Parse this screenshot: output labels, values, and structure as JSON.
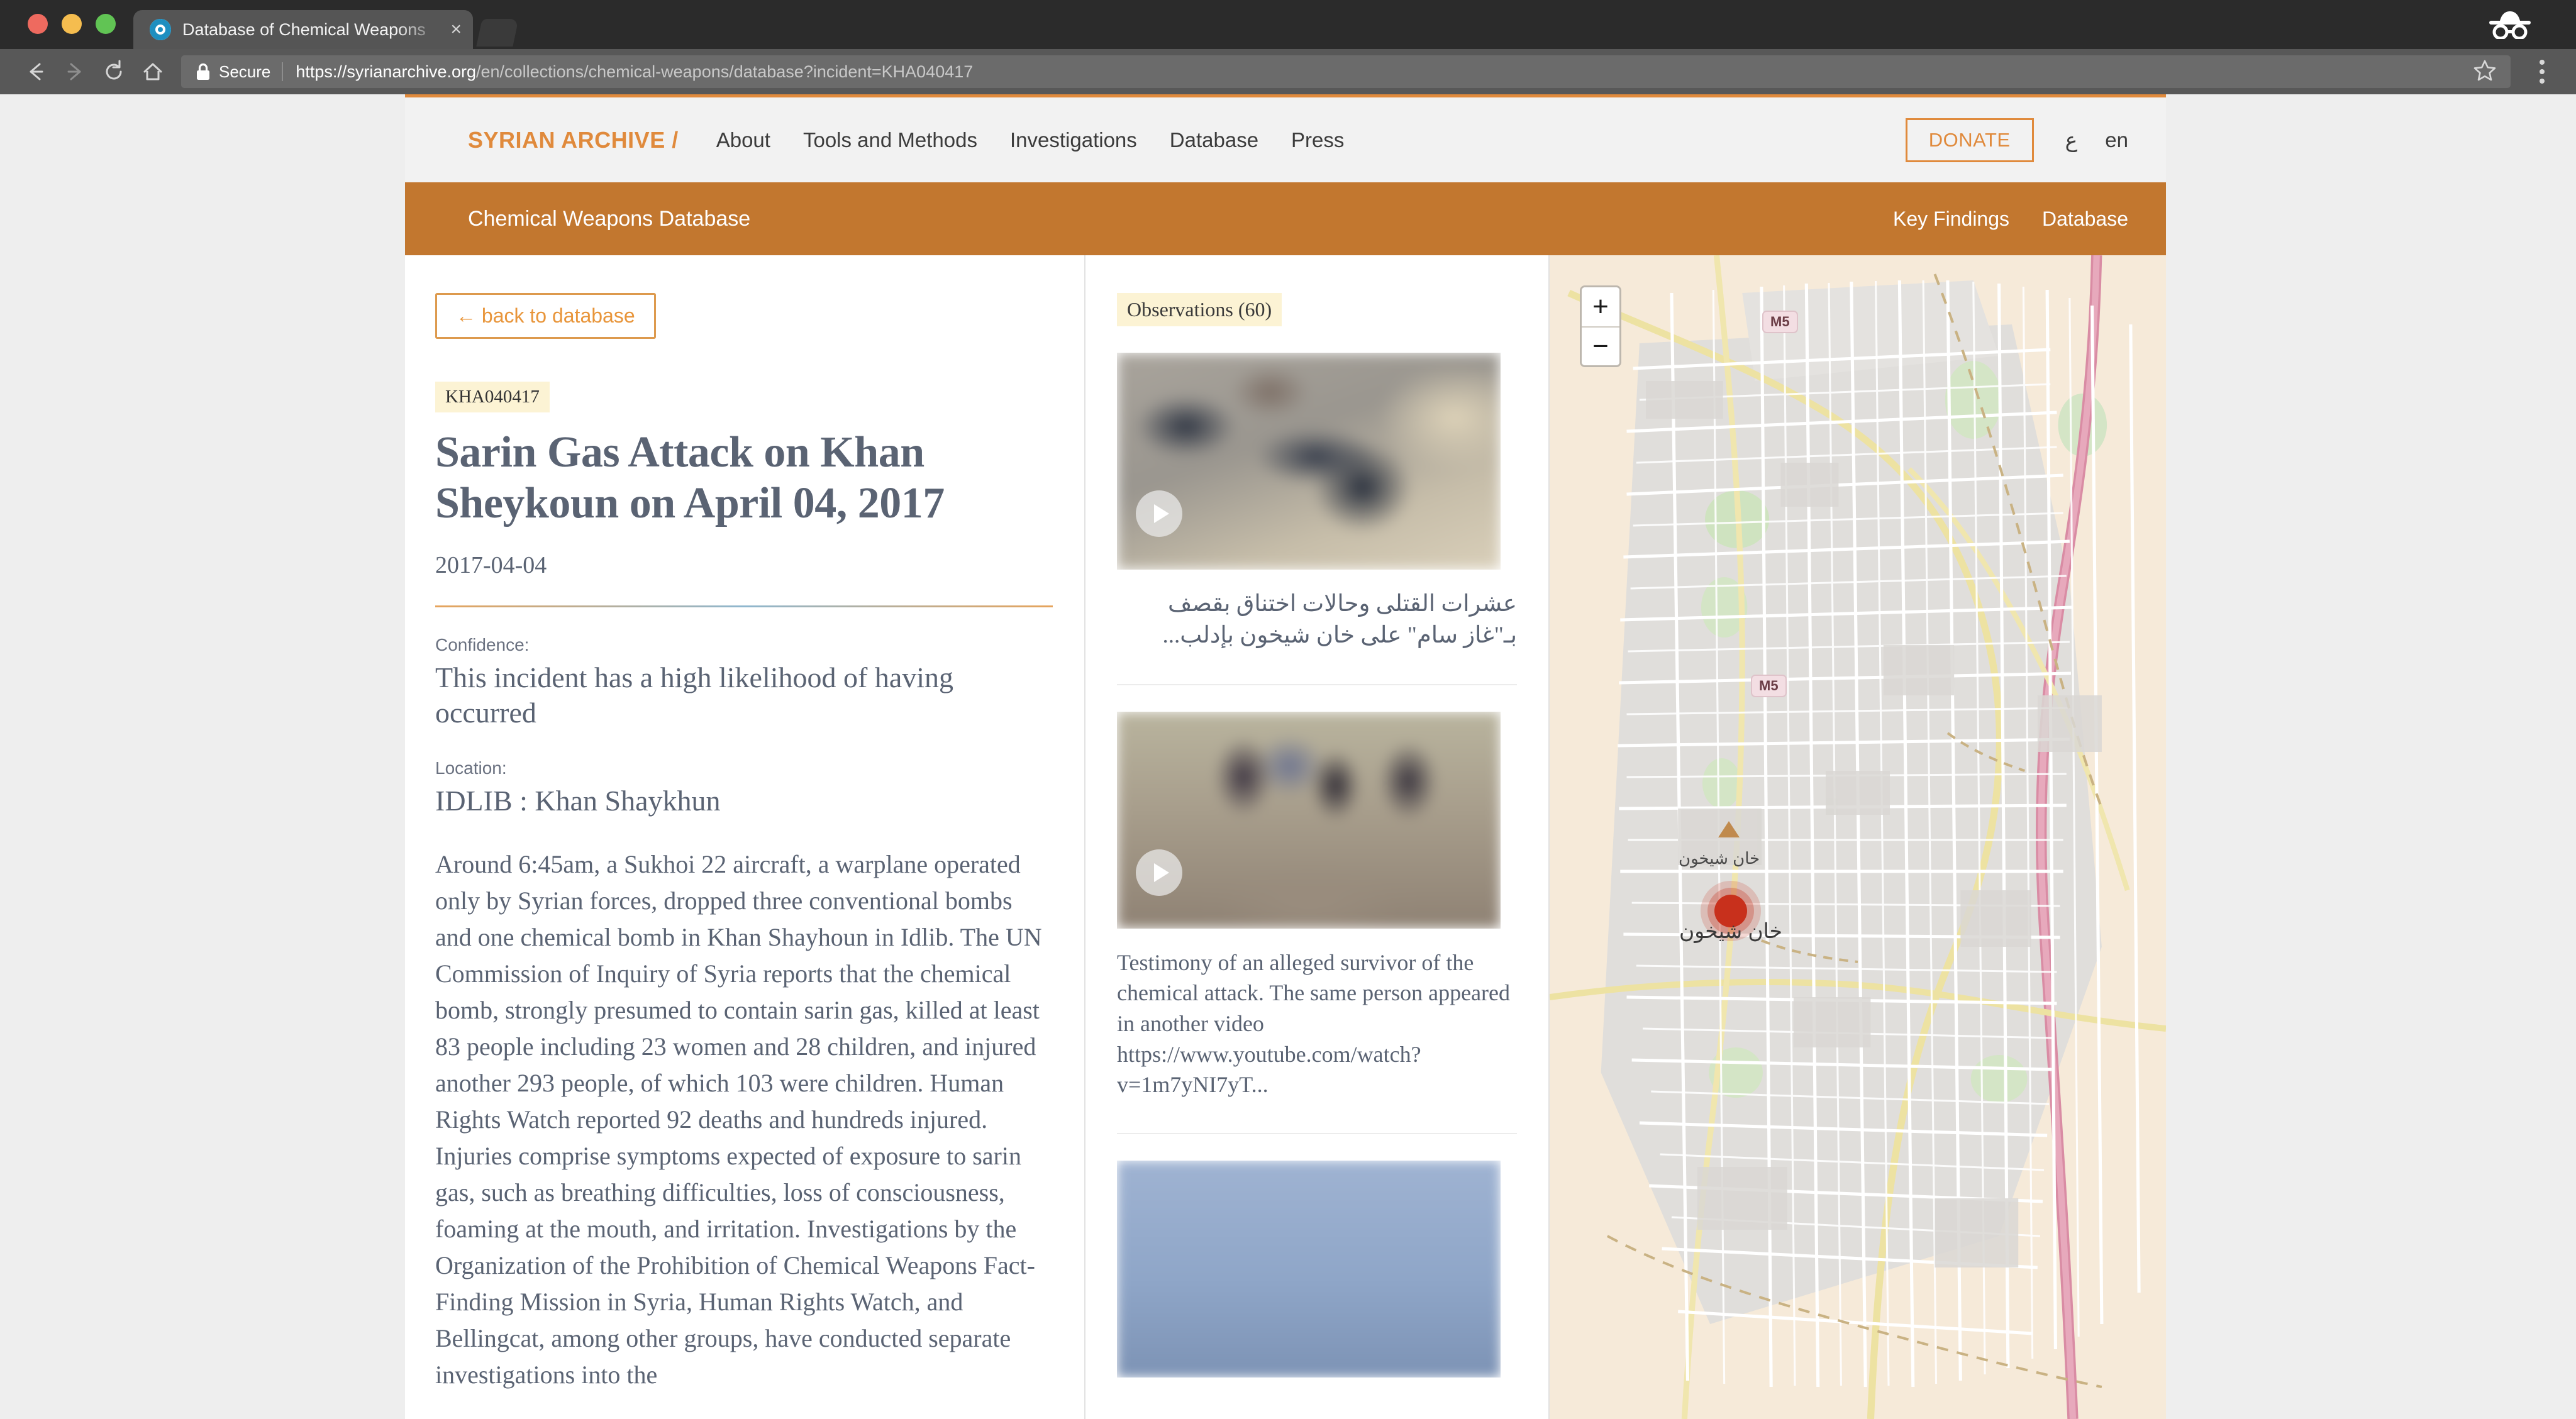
{
  "browser": {
    "tab_title": "Database of Chemical Weapons",
    "tab_close_glyph": "×",
    "back_glyph": "←",
    "forward_glyph": "→",
    "reload_glyph": "↻",
    "home_glyph": "⌂",
    "secure_label": "Secure",
    "url_host": "https://syrianarchive.org",
    "url_path": "/en/collections/chemical-weapons/database?incident=KHA040417",
    "star_glyph": "☆"
  },
  "mainnav": {
    "brand": "SYRIAN ARCHIVE /",
    "links": [
      {
        "label": "About"
      },
      {
        "label": "Tools and Methods"
      },
      {
        "label": "Investigations"
      },
      {
        "label": "Database"
      },
      {
        "label": "Press"
      }
    ],
    "donate_label": "DONATE",
    "lang_ar": "ع",
    "lang_en": "en"
  },
  "subnav": {
    "title": "Chemical Weapons Database",
    "links": [
      {
        "label": "Key Findings"
      },
      {
        "label": "Database"
      }
    ]
  },
  "incident": {
    "back_label": "← back to database",
    "id": "KHA040417",
    "title": "Sarin Gas Attack on Khan Sheykoun on April 04, 2017",
    "date": "2017-04-04",
    "confidence_label": "Confidence:",
    "confidence_value": "This incident has a high likelihood of having occurred",
    "location_label": "Location:",
    "location_value": "IDLIB : Khan Shaykhun",
    "description": "Around 6:45am, a Sukhoi 22 aircraft, a warplane operated only by Syrian forces, dropped three conventional bombs and one chemical bomb in Khan Shayhoun in Idlib.  The UN Commission of Inquiry of Syria  reports that the chemical bomb, strongly presumed to contain sarin gas, killed at least 83 people including 23 women and 28 children, and injured another 293 people, of which 103 were children. Human Rights Watch reported 92 deaths and hundreds injured. Injuries comprise symptoms expected of exposure to sarin gas, such as breathing difficulties, loss of consciousness, foaming at the mouth, and irritation. Investigations by the Organization of the Prohibition of Chemical Weapons Fact-Finding Mission in Syria, Human Rights Watch, and Bellingcat, among other groups, have conducted separate investigations into the"
  },
  "observations": {
    "header": "Observations (60)",
    "count": 60,
    "items": [
      {
        "caption": "عشرات القتلى وحالات اختناق بقصف بـ\"غاز سام\" على خان شيخون بإدلب...",
        "rtl": true,
        "media": "video"
      },
      {
        "caption": "Testimony of an alleged survivor of the chemical attack. The same person appeared in another video https://www.youtube.com/watch?v=1m7yNI7yT...",
        "rtl": false,
        "media": "video"
      },
      {
        "caption": "",
        "rtl": false,
        "media": "video"
      }
    ]
  },
  "map": {
    "zoom_in": "+",
    "zoom_out": "−",
    "marker_label": "خان شيخون",
    "labels": [
      {
        "text": "خان شيخون"
      },
      {
        "text": "خان شيخون"
      }
    ],
    "shields": [
      {
        "text": "M5"
      },
      {
        "text": "M5"
      }
    ]
  },
  "colors": {
    "brand_orange": "#e08a3c",
    "subnav_orange": "#c2772f",
    "heading_slate": "#5a6373",
    "badge_cream": "#fcf3d4",
    "marker_red": "#c8301c",
    "map_bg": "#f3e6d4"
  }
}
